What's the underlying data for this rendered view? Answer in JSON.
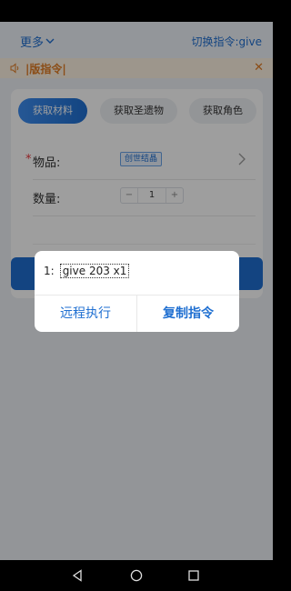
{
  "header": {
    "more_label": "更多",
    "switch_label": "切换指令:give"
  },
  "notice": {
    "text": "|版指令|"
  },
  "tabs": [
    {
      "label": "获取材料",
      "active": true
    },
    {
      "label": "获取圣遗物",
      "active": false
    },
    {
      "label": "获取角色",
      "active": false
    }
  ],
  "form": {
    "item_label": "物品:",
    "item_required_mark": "*",
    "item_value": "创世结晶",
    "quantity_label": "数量:",
    "quantity_minus": "−",
    "quantity_value": "1",
    "quantity_plus": "+"
  },
  "dialog": {
    "command_index": "1:",
    "command_text": "give 203 x1",
    "remote_button": "远程执行",
    "copy_button": "复制指令"
  },
  "colors": {
    "accent": "#1f6fd1",
    "notice": "#e07b23",
    "required": "#e8383d"
  }
}
